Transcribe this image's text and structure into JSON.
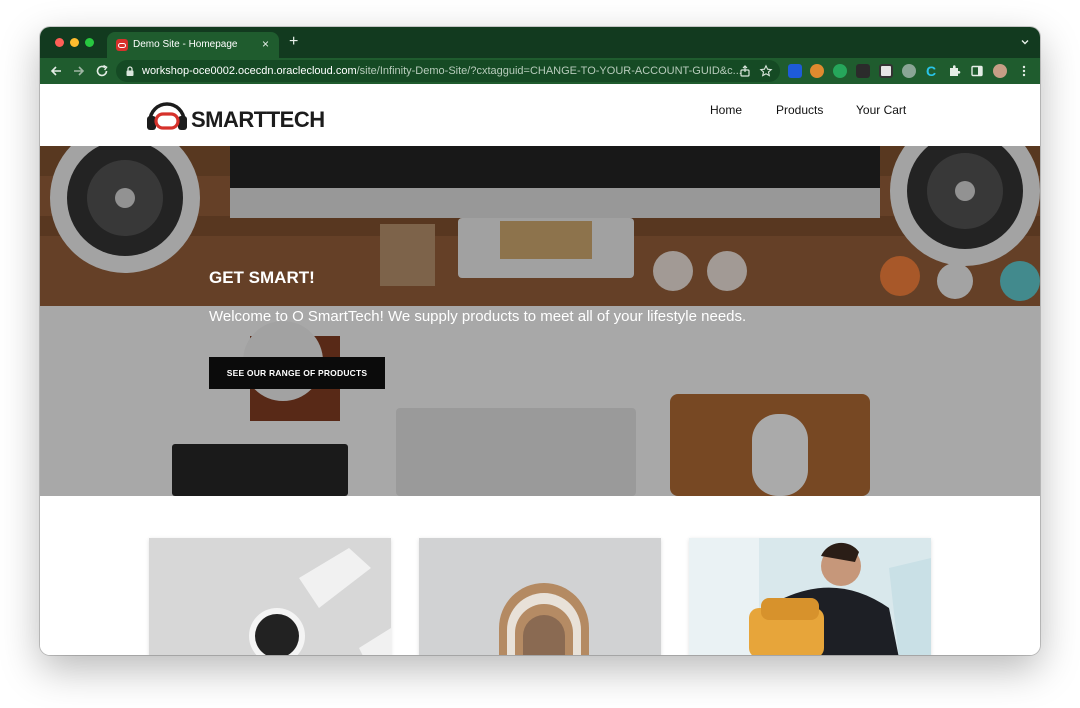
{
  "browser": {
    "tab_title": "Demo Site - Homepage",
    "tab_close": "×",
    "new_tab": "+",
    "url_host": "workshop-oce0002.ocecdn.oraclecloud.com",
    "url_path": "/site/Infinity-Demo-Site/?cxtagguid=CHANGE-TO-YOUR-ACCOUNT-GUID&c...",
    "theme_color": "#1f5c2e",
    "tabstrip_color": "#123a1f"
  },
  "site": {
    "logo_text": "SMARTTECH",
    "nav": [
      "Home",
      "Products",
      "Your Cart"
    ]
  },
  "hero": {
    "title": "GET SMART!",
    "text": "Welcome to O SmartTech! We supply products to meet all of your lifestyle needs.",
    "button": "SEE OUR RANGE OF PRODUCTS"
  },
  "cards": [
    {
      "icon": "smartwatch-image"
    },
    {
      "icon": "arch-lamp-image"
    },
    {
      "icon": "backpack-man-image"
    }
  ]
}
